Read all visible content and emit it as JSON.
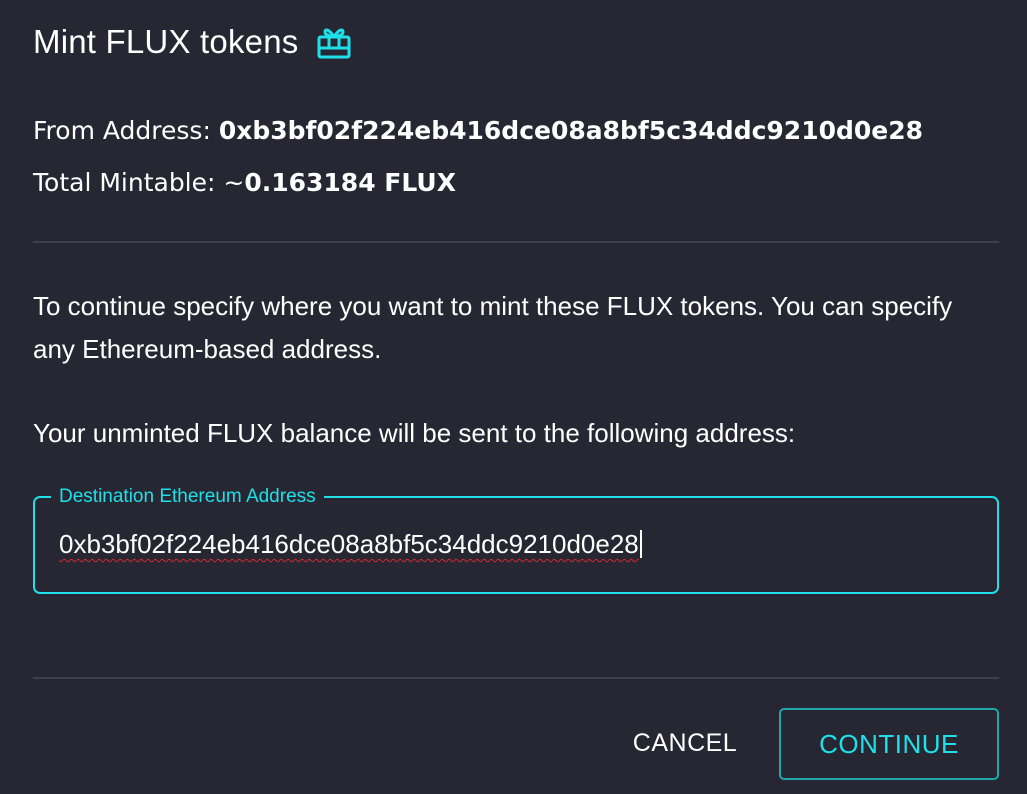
{
  "dialog": {
    "title": "Mint FLUX tokens",
    "title_icon": "gift-icon"
  },
  "info": {
    "from_label": "From Address: ",
    "from_value": "0xb3bf02f224eb416dce08a8bf5c34ddc9210d0e28",
    "mintable_label": "Total Mintable: ~",
    "mintable_value": "0.163184 FLUX"
  },
  "body": {
    "paragraph1": "To continue specify where you want to mint these FLUX tokens. You can specify any Ethereum-based address.",
    "paragraph2": "Your unminted FLUX balance will be sent to the following address:"
  },
  "destination": {
    "label": "Destination Ethereum Address",
    "value": "0xb3bf02f224eb416dce08a8bf5c34ddc9210d0e28"
  },
  "actions": {
    "cancel_label": "CANCEL",
    "continue_label": "CONTINUE"
  },
  "colors": {
    "background": "#262733",
    "accent": "#1fe0e8",
    "divider": "#3e404d"
  }
}
